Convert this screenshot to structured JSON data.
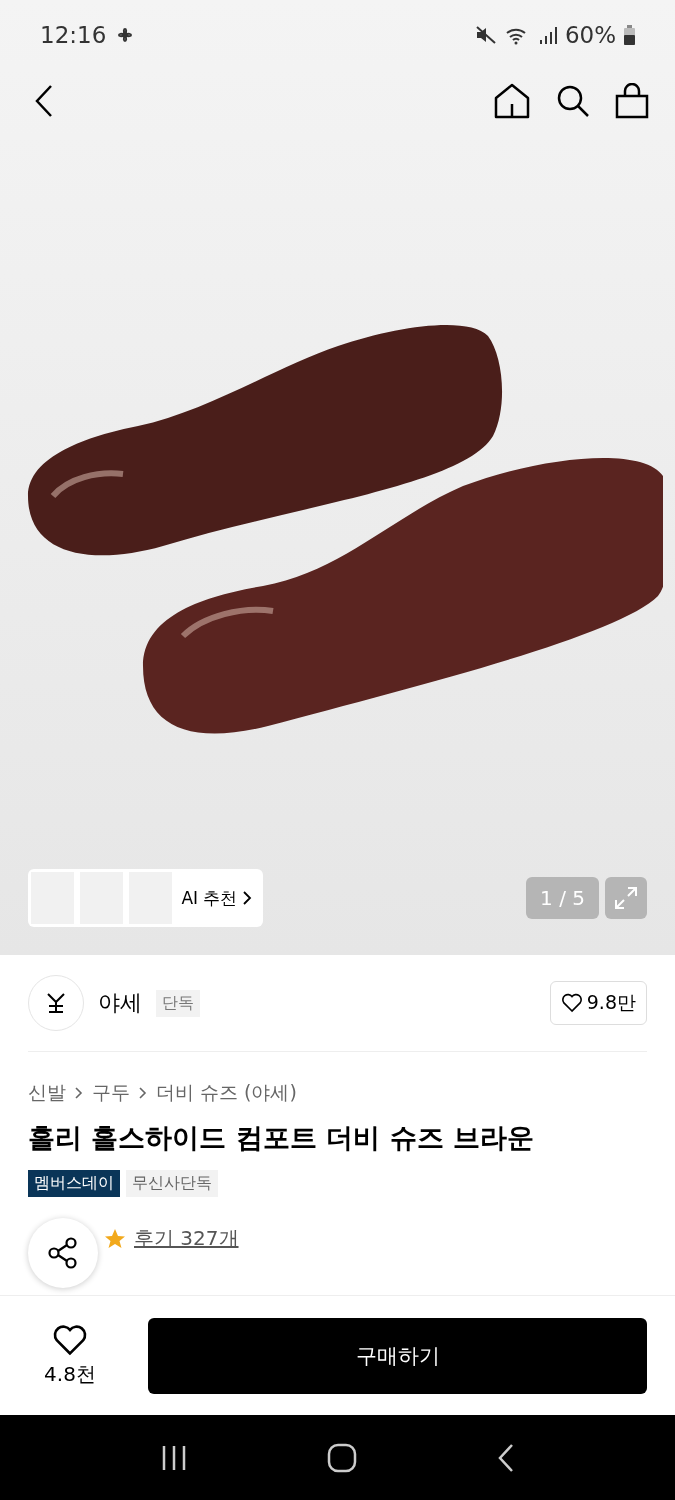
{
  "status_bar": {
    "time": "12:16",
    "battery": "60%"
  },
  "gallery": {
    "ai_recommend": "AI 추천",
    "counter": "1 / 5"
  },
  "brand": {
    "name": "야세",
    "tag": "단독",
    "likes": "9.8만"
  },
  "breadcrumbs": [
    "신발",
    "구두",
    "더비 슈즈 (야세)"
  ],
  "title": "홀리 홀스하이드 컴포트 더비 슈즈 브라운",
  "badges": [
    {
      "label": "멤버스데이",
      "kind": "member"
    },
    {
      "label": "무신사단독",
      "kind": "exclusive"
    }
  ],
  "reviews": {
    "label": "후기 327개"
  },
  "bottom_bar": {
    "likes": "4.8천",
    "buy": "구매하기"
  }
}
